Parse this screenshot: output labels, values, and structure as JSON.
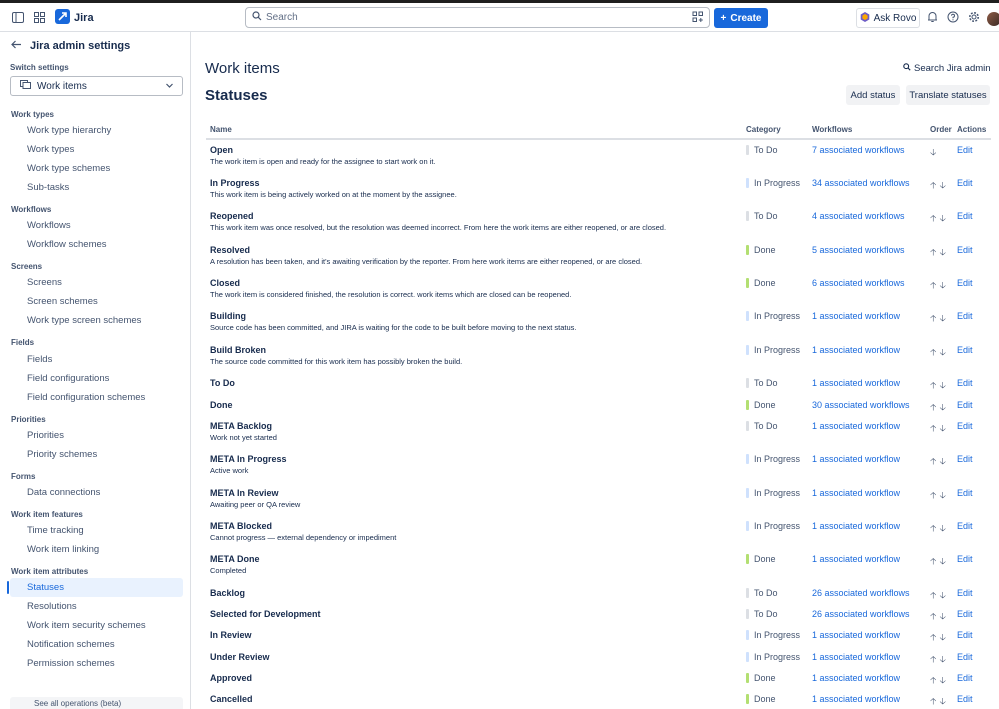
{
  "colors": {
    "accent": "#1868db",
    "category_todo": "#dcdfe4",
    "category_in_progress": "#cfe1fd",
    "category_done": "#b3df72"
  },
  "topbar": {
    "app_name": "Jira",
    "search_placeholder": "Search",
    "create_label": "Create",
    "ask_rovo_label": "Ask Rovo"
  },
  "sidebar": {
    "title": "Jira admin settings",
    "switch_label": "Switch settings",
    "switch_value": "Work items",
    "sections": [
      {
        "heading": "Work types",
        "items": [
          "Work type hierarchy",
          "Work types",
          "Work type schemes",
          "Sub-tasks"
        ]
      },
      {
        "heading": "Workflows",
        "items": [
          "Workflows",
          "Workflow schemes"
        ]
      },
      {
        "heading": "Screens",
        "items": [
          "Screens",
          "Screen schemes",
          "Work type screen schemes"
        ]
      },
      {
        "heading": "Fields",
        "items": [
          "Fields",
          "Field configurations",
          "Field configuration schemes"
        ]
      },
      {
        "heading": "Priorities",
        "items": [
          "Priorities",
          "Priority schemes"
        ]
      },
      {
        "heading": "Forms",
        "items": [
          "Data connections"
        ]
      },
      {
        "heading": "Work item features",
        "items": [
          "Time tracking",
          "Work item linking"
        ]
      },
      {
        "heading": "Work item attributes",
        "items": [
          "Statuses",
          "Resolutions",
          "Work item security schemes",
          "Notification schemes",
          "Permission schemes"
        ]
      }
    ],
    "active_item": "Statuses",
    "footer_text": "See all operations (beta)"
  },
  "main": {
    "title": "Work items",
    "subtitle": "Statuses",
    "search_admin_label": "Search Jira admin",
    "add_status_label": "Add status",
    "translate_label": "Translate statuses",
    "columns": {
      "name": "Name",
      "category": "Category",
      "workflows": "Workflows",
      "order": "Order",
      "actions": "Actions"
    },
    "edit_label": "Edit",
    "rows": [
      {
        "name": "Open",
        "desc": "The work item is open and ready for the assignee to start work on it.",
        "category": "To Do",
        "workflows": "7 associated workflows",
        "order": "down"
      },
      {
        "name": "In Progress",
        "desc": "This work item is being actively worked on at the moment by the assignee.",
        "category": "In Progress",
        "workflows": "34 associated workflows",
        "order": "both"
      },
      {
        "name": "Reopened",
        "desc": "This work item was once resolved, but the resolution was deemed incorrect. From here the work items are either reopened, or are closed.",
        "category": "To Do",
        "workflows": "4 associated workflows",
        "order": "both"
      },
      {
        "name": "Resolved",
        "desc": "A resolution has been taken, and it's awaiting verification by the reporter. From here work items are either reopened, or are closed.",
        "category": "Done",
        "workflows": "5 associated workflows",
        "order": "both"
      },
      {
        "name": "Closed",
        "desc": "The work item is considered finished, the resolution is correct. work items which are closed can be reopened.",
        "category": "Done",
        "workflows": "6 associated workflows",
        "order": "both"
      },
      {
        "name": "Building",
        "desc": "Source code has been committed, and JIRA is waiting for the code to be built before moving to the next status.",
        "category": "In Progress",
        "workflows": "1 associated workflow",
        "order": "both"
      },
      {
        "name": "Build Broken",
        "desc": "The source code committed for this work item has possibly broken the build.",
        "category": "In Progress",
        "workflows": "1 associated workflow",
        "order": "both"
      },
      {
        "name": "To Do",
        "desc": "",
        "category": "To Do",
        "workflows": "1 associated workflow",
        "order": "both"
      },
      {
        "name": "Done",
        "desc": "",
        "category": "Done",
        "workflows": "30 associated workflows",
        "order": "both"
      },
      {
        "name": "META Backlog",
        "desc": "Work not yet started",
        "category": "To Do",
        "workflows": "1 associated workflow",
        "order": "both"
      },
      {
        "name": "META In Progress",
        "desc": "Active work",
        "category": "In Progress",
        "workflows": "1 associated workflow",
        "order": "both"
      },
      {
        "name": "META In Review",
        "desc": "Awaiting peer or QA review",
        "category": "In Progress",
        "workflows": "1 associated workflow",
        "order": "both"
      },
      {
        "name": "META Blocked",
        "desc": "Cannot progress — external dependency or impediment",
        "category": "In Progress",
        "workflows": "1 associated workflow",
        "order": "both"
      },
      {
        "name": "META Done",
        "desc": "Completed",
        "category": "Done",
        "workflows": "1 associated workflow",
        "order": "both"
      },
      {
        "name": "Backlog",
        "desc": "",
        "category": "To Do",
        "workflows": "26 associated workflows",
        "order": "both"
      },
      {
        "name": "Selected for Development",
        "desc": "",
        "category": "To Do",
        "workflows": "26 associated workflows",
        "order": "both"
      },
      {
        "name": "In Review",
        "desc": "",
        "category": "In Progress",
        "workflows": "1 associated workflow",
        "order": "both"
      },
      {
        "name": "Under Review",
        "desc": "",
        "category": "In Progress",
        "workflows": "1 associated workflow",
        "order": "both"
      },
      {
        "name": "Approved",
        "desc": "",
        "category": "Done",
        "workflows": "1 associated workflow",
        "order": "both"
      },
      {
        "name": "Cancelled",
        "desc": "",
        "category": "Done",
        "workflows": "1 associated workflow",
        "order": "both"
      }
    ]
  }
}
